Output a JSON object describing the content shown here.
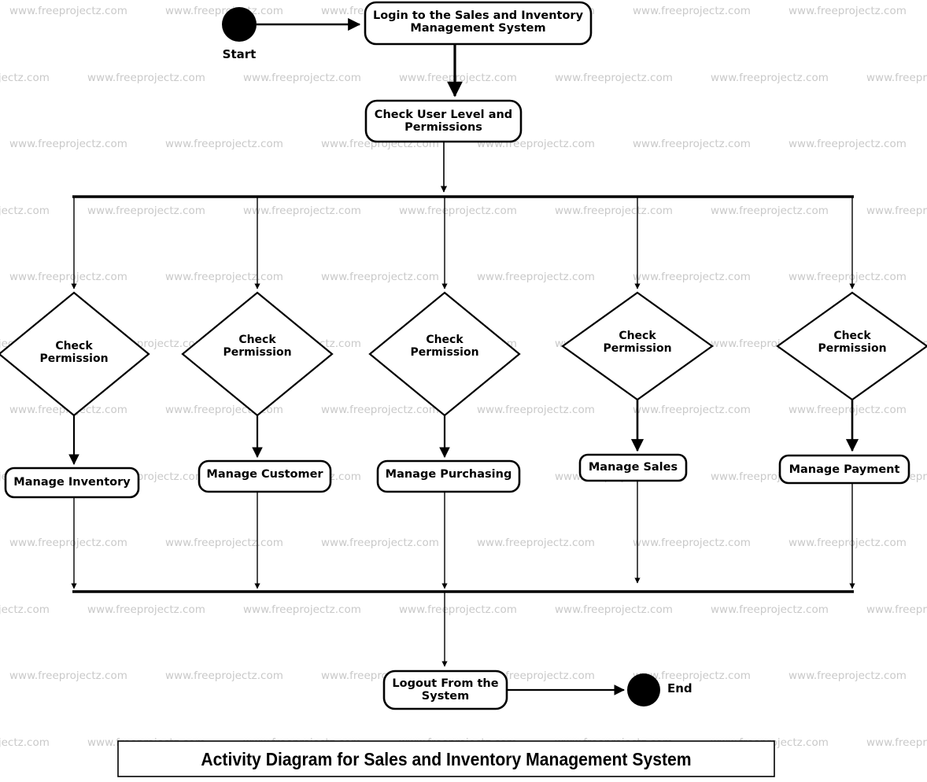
{
  "diagram": {
    "title": "Activity Diagram for Sales and Inventory Management System",
    "type": "UML Activity Diagram",
    "watermark_text": "www.freeprojectz.com",
    "colors": {
      "stroke": "#000000",
      "fill": "#ffffff",
      "watermark": "#c9c9c9",
      "background": "#ffffff"
    },
    "nodes": {
      "start": {
        "label": "Start",
        "kind": "initial-node"
      },
      "login": {
        "label": "Login to the Sales and Inventory Management System",
        "line1": "Login to the Sales and Inventory",
        "line2": "Management System",
        "kind": "action"
      },
      "check_user": {
        "label": "Check User Level and Permissions",
        "line1": "Check User Level and",
        "line2": "Permissions",
        "kind": "action"
      },
      "fork": {
        "label": "Fork",
        "kind": "fork-bar"
      },
      "join": {
        "label": "Join",
        "kind": "join-bar"
      },
      "decisions": [
        {
          "id": "check-permission-inventory",
          "line1": "Check",
          "line2": "Permission"
        },
        {
          "id": "check-permission-customer",
          "line1": "Check",
          "line2": "Permission"
        },
        {
          "id": "check-permission-purchasing",
          "line1": "Check",
          "line2": "Permission"
        },
        {
          "id": "check-permission-sales",
          "line1": "Check",
          "line2": "Permission"
        },
        {
          "id": "check-permission-payment",
          "line1": "Check",
          "line2": "Permission"
        }
      ],
      "actions": [
        {
          "id": "manage-inventory",
          "label": "Manage Inventory"
        },
        {
          "id": "manage-customer",
          "label": "Manage Customer"
        },
        {
          "id": "manage-purchasing",
          "label": "Manage Purchasing"
        },
        {
          "id": "manage-sales",
          "label": "Manage Sales"
        },
        {
          "id": "manage-payment",
          "label": "Manage Payment"
        }
      ],
      "logout": {
        "label": "Logout From the System",
        "line1": "Logout From the",
        "line2": "System",
        "kind": "action"
      },
      "end": {
        "label": "End",
        "kind": "final-node"
      }
    }
  }
}
